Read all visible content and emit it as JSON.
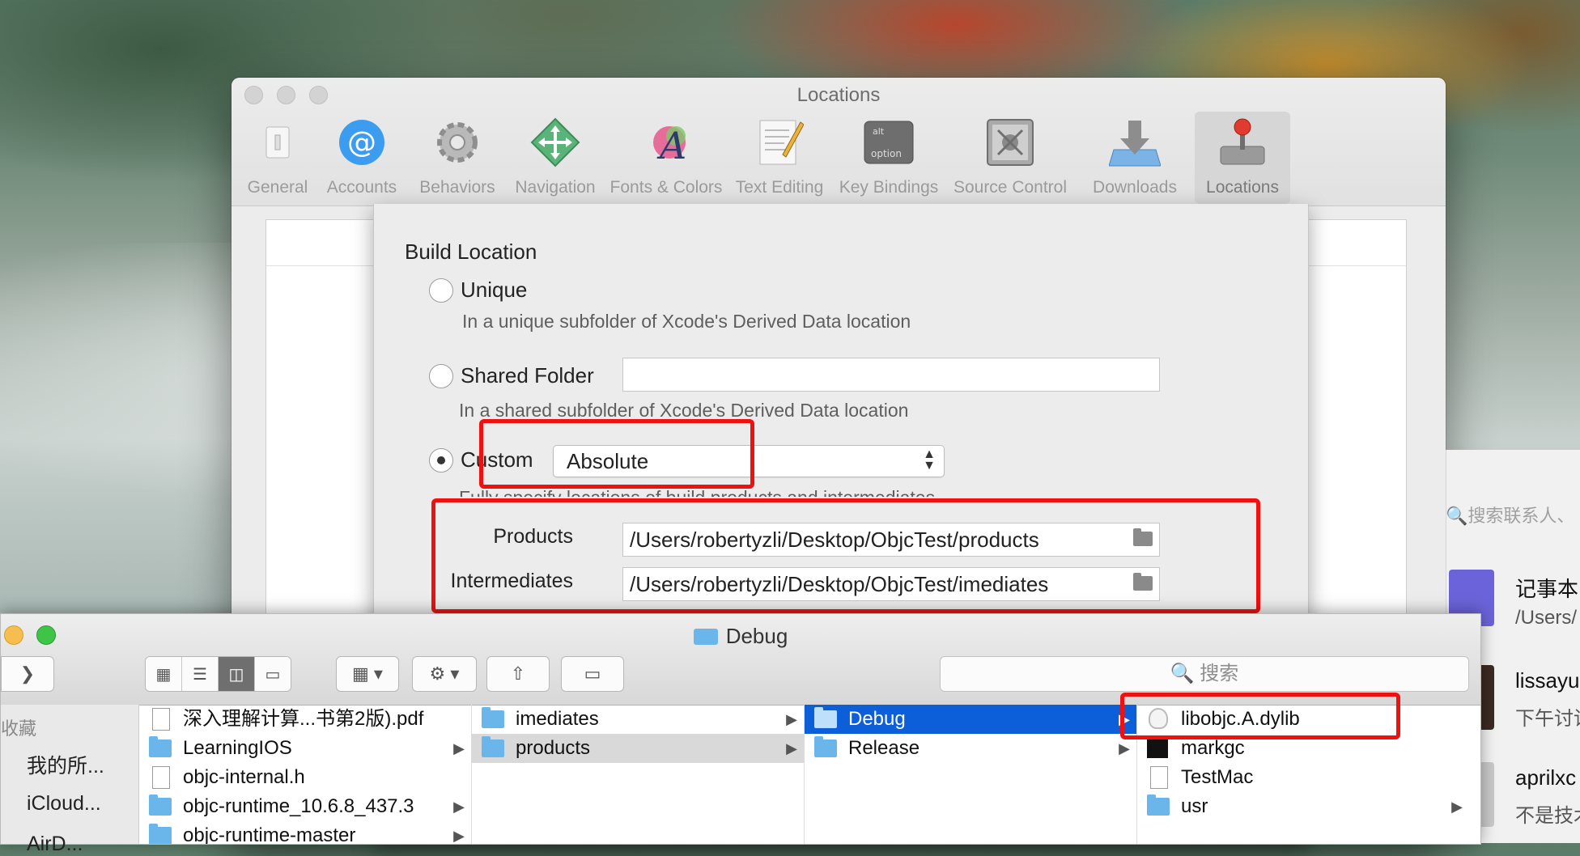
{
  "prefs": {
    "title": "Locations",
    "toolbar": [
      {
        "label": "General",
        "icon": "general-icon"
      },
      {
        "label": "Accounts",
        "icon": "at-sign-icon"
      },
      {
        "label": "Behaviors",
        "icon": "gear-icon"
      },
      {
        "label": "Navigation",
        "icon": "navigation-arrows-icon"
      },
      {
        "label": "Fonts & Colors",
        "icon": "fonts-colors-icon"
      },
      {
        "label": "Text Editing",
        "icon": "text-editing-icon"
      },
      {
        "label": "Key Bindings",
        "icon": "key-bindings-icon"
      },
      {
        "label": "Source Control",
        "icon": "source-control-icon"
      },
      {
        "label": "Downloads",
        "icon": "downloads-icon"
      },
      {
        "label": "Locations",
        "icon": "locations-joystick-icon",
        "selected": true
      }
    ],
    "key_label_top": "alt",
    "key_label_bottom": "option"
  },
  "sheet": {
    "title": "Build Location",
    "options": [
      {
        "label": "Unique",
        "description": "In a unique subfolder of Xcode's Derived Data location",
        "selected": false
      },
      {
        "label": "Shared Folder",
        "description": "In a shared subfolder of Xcode's Derived Data location",
        "selected": false,
        "field_value": ""
      },
      {
        "label": "Custom",
        "description": "Fully specify locations of build products and intermediates",
        "selected": true,
        "popup_value": "Absolute"
      }
    ],
    "paths": [
      {
        "label": "Products",
        "value": "/Users/robertyzli/Desktop/ObjcTest/products"
      },
      {
        "label": "Intermediates",
        "value": "/Users/robertyzli/Desktop/ObjcTest/imediates"
      }
    ]
  },
  "chat": {
    "search_placeholder": "搜索联系人、",
    "items": [
      {
        "name": "记事本",
        "sub": "/Users/"
      },
      {
        "name": "lissayu",
        "sub": "下午讨论"
      },
      {
        "name": "aprilxc",
        "sub": "不是技术"
      }
    ]
  },
  "finder": {
    "title": "Debug",
    "search_placeholder": "搜索",
    "sidebar": {
      "heading": "收藏",
      "items": [
        "我的所...",
        "iCloud...",
        "AirD..."
      ]
    },
    "columns": [
      [
        {
          "name": "深入理解计算...书第2版).pdf",
          "kind": "doc"
        },
        {
          "name": "LearningIOS",
          "kind": "folder",
          "chevron": true
        },
        {
          "name": "objc-internal.h",
          "kind": "doc"
        },
        {
          "name": "objc-runtime_10.6.8_437.3",
          "kind": "folder",
          "chevron": true
        },
        {
          "name": "objc-runtime-master",
          "kind": "folder",
          "chevron": true
        }
      ],
      [
        {
          "name": "imediates",
          "kind": "folder",
          "chevron": true
        },
        {
          "name": "products",
          "kind": "folder",
          "chevron": true,
          "state": "selected-gray"
        }
      ],
      [
        {
          "name": "Debug",
          "kind": "folder",
          "chevron": true,
          "state": "selected-blue"
        },
        {
          "name": "Release",
          "kind": "folder",
          "chevron": true
        }
      ],
      [
        {
          "name": "libobjc.A.dylib",
          "kind": "lib"
        },
        {
          "name": "markgc",
          "kind": "exec"
        },
        {
          "name": "TestMac",
          "kind": "app"
        },
        {
          "name": "usr",
          "kind": "folder",
          "chevron": true
        }
      ]
    ]
  },
  "colors": {
    "highlight_red": "#ef1010",
    "selection_blue": "#0d5fd9",
    "folder_blue": "#6ab6ea"
  }
}
